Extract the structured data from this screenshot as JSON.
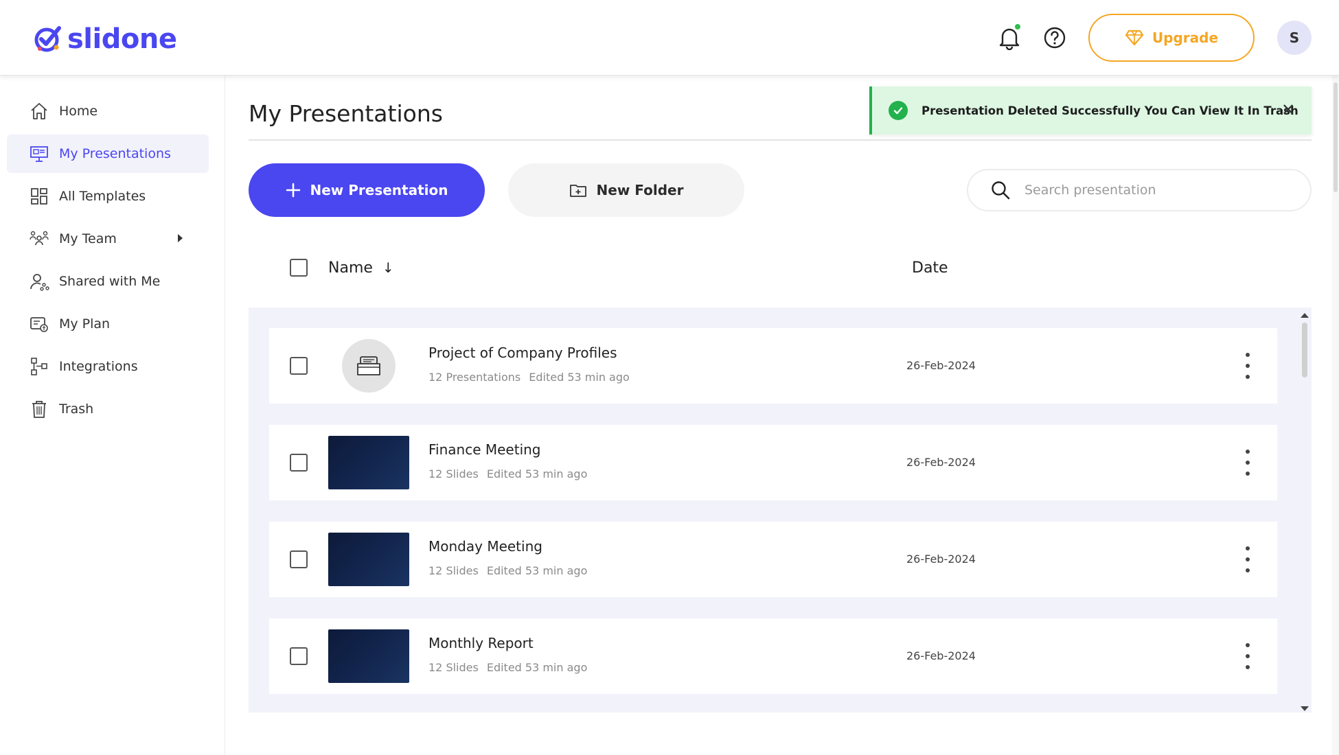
{
  "app": {
    "brand": "slidone",
    "upgrade_label": "Upgrade",
    "avatar_initial": "S",
    "accent_color": "#4a46f0",
    "upgrade_color": "#f5a623",
    "success_color": "#22b14c"
  },
  "sidebar": {
    "items": [
      {
        "label": "Home",
        "icon": "home-icon",
        "active": false
      },
      {
        "label": "My Presentations",
        "icon": "presentation-icon",
        "active": true
      },
      {
        "label": "All Templates",
        "icon": "templates-grid-icon",
        "active": false
      },
      {
        "label": "My Team",
        "icon": "team-icon",
        "active": false,
        "has_submenu": true
      },
      {
        "label": "Shared with Me",
        "icon": "shared-user-icon",
        "active": false
      },
      {
        "label": "My Plan",
        "icon": "plan-icon",
        "active": false
      },
      {
        "label": "Integrations",
        "icon": "integrations-icon",
        "active": false
      },
      {
        "label": "Trash",
        "icon": "trash-icon",
        "active": false
      }
    ]
  },
  "main": {
    "title": "My Presentations",
    "new_presentation_label": "New Presentation",
    "new_folder_label": "New Folder",
    "search_placeholder": "Search presentation",
    "columns": {
      "name": "Name",
      "date": "Date"
    }
  },
  "toast": {
    "message": "Presentation Deleted Successfully You Can View It In Trash"
  },
  "rows": [
    {
      "name": "Project of Company Profiles",
      "count": "12 Presentations",
      "edited": "Edited 53 min ago",
      "date": "26-Feb-2024",
      "type": "folder"
    },
    {
      "name": "Finance Meeting",
      "count": "12 Slides",
      "edited": "Edited 53 min ago",
      "date": "26-Feb-2024",
      "type": "presentation"
    },
    {
      "name": "Monday Meeting",
      "count": "12 Slides",
      "edited": "Edited 53 min ago",
      "date": "26-Feb-2024",
      "type": "presentation"
    },
    {
      "name": "Monthly Report",
      "count": "12 Slides",
      "edited": "Edited 53 min ago",
      "date": "26-Feb-2024",
      "type": "presentation"
    }
  ]
}
